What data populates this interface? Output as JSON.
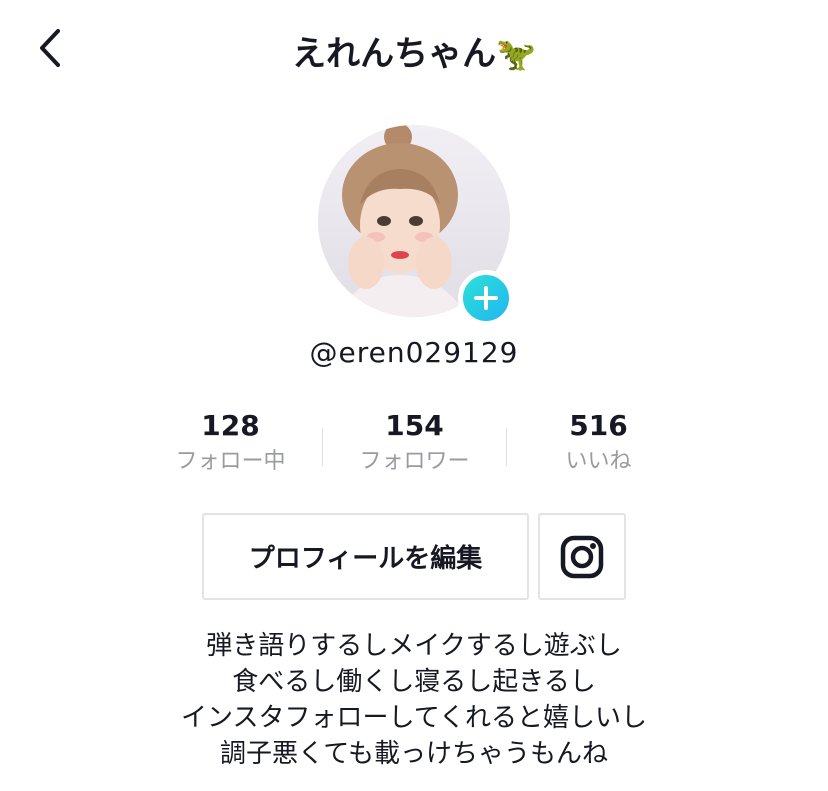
{
  "header": {
    "title": "えれんちゃん",
    "title_emoji": "🦖",
    "back_icon": "chevron-left-icon"
  },
  "profile": {
    "username": "@eren029129",
    "avatar_icon": "avatar",
    "add_icon": "plus-icon",
    "accent_color": "#20b8f0"
  },
  "stats": [
    {
      "value": "128",
      "label": "フォロー中"
    },
    {
      "value": "154",
      "label": "フォロワー"
    },
    {
      "value": "516",
      "label": "いいね"
    }
  ],
  "actions": {
    "edit_profile_label": "プロフィールを編集",
    "instagram_icon": "instagram-icon"
  },
  "bio": [
    "弾き語りするしメイクするし遊ぶし",
    "食べるし働くし寝るし起きるし",
    "インスタフォローしてくれると嬉しいし",
    "調子悪くても載っけちゃうもんね"
  ]
}
